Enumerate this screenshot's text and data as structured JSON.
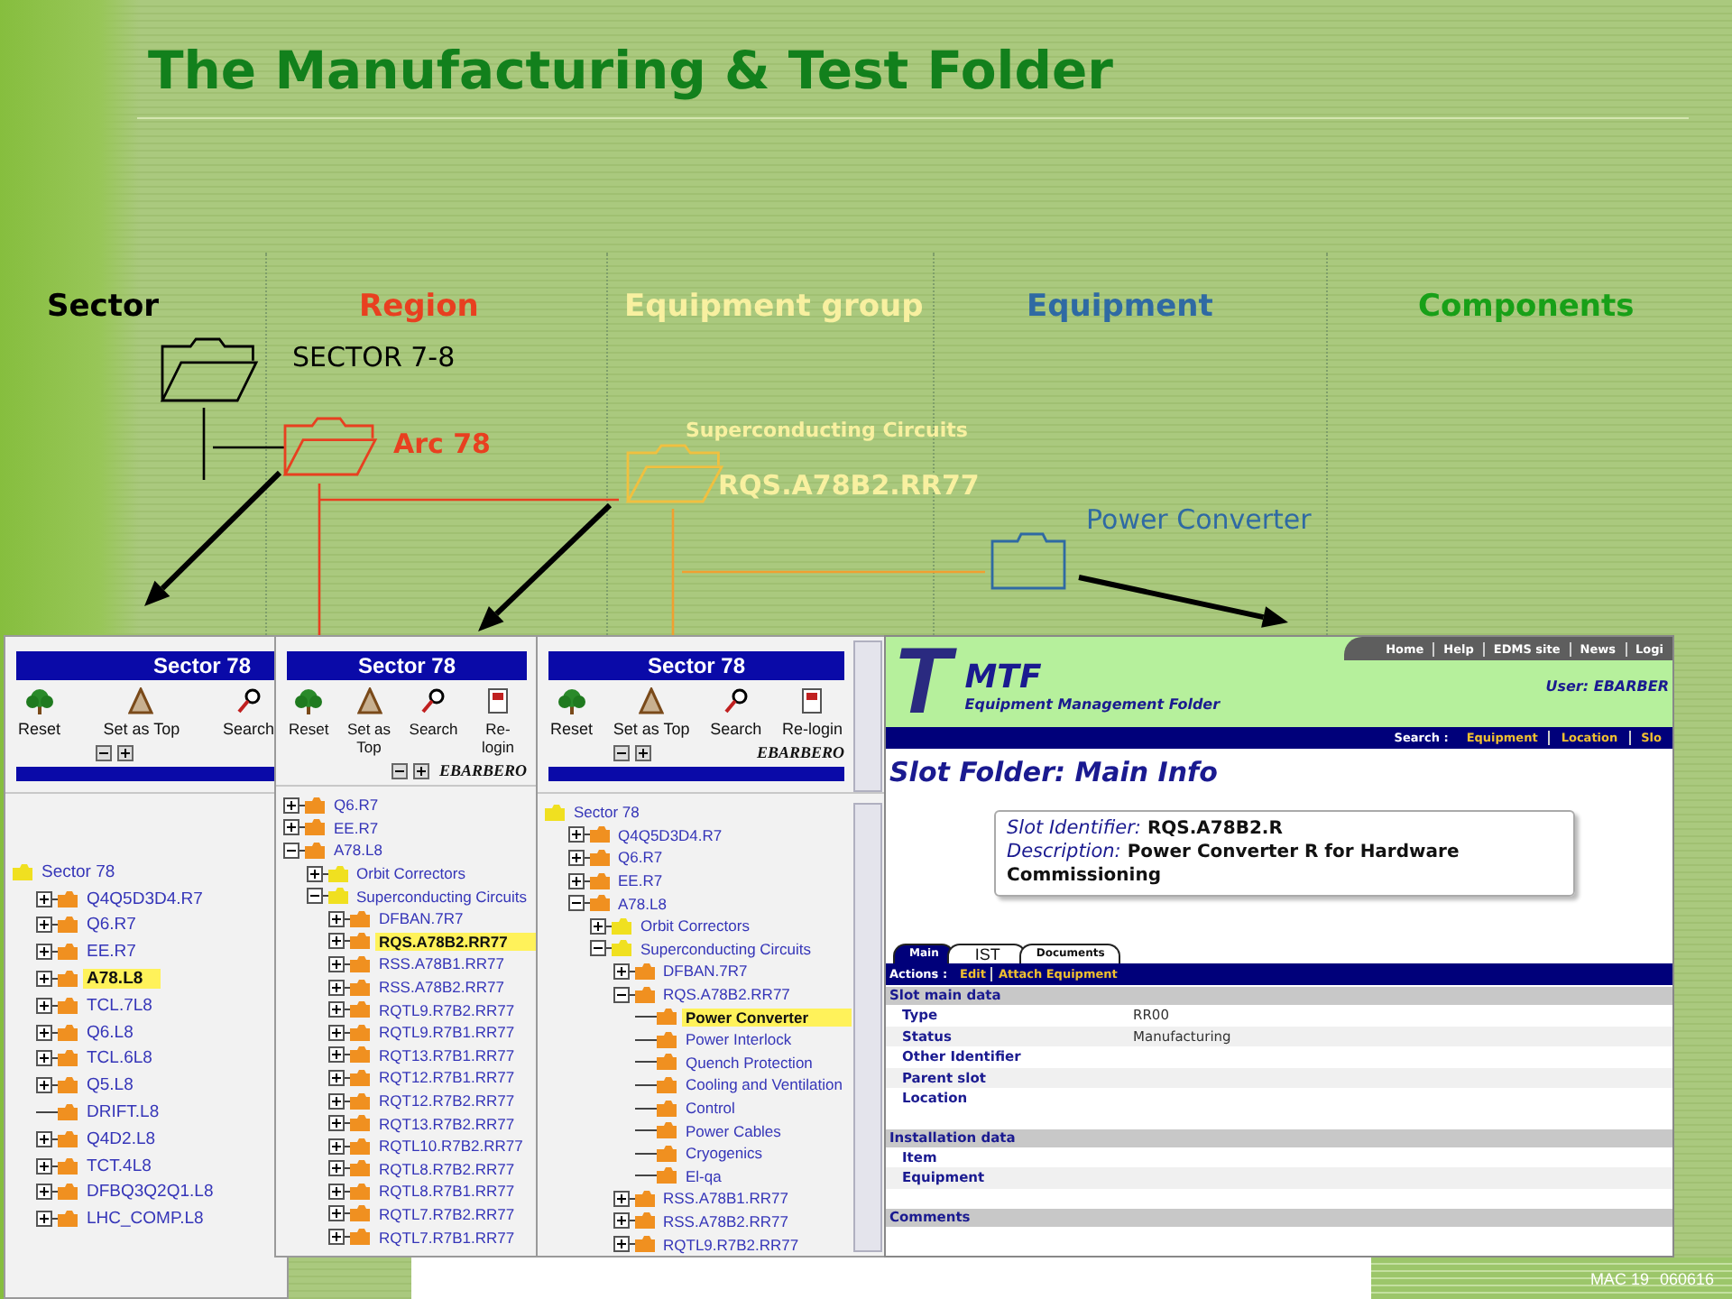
{
  "title": "The Manufacturing & Test Folder",
  "columns": [
    {
      "label": "Sector",
      "color": "#000000"
    },
    {
      "label": "Region",
      "color": "#e84020"
    },
    {
      "label": "Equipment group",
      "color": "#f8f0a0"
    },
    {
      "label": "Equipment",
      "color": "#2f6aa3"
    },
    {
      "label": "Components",
      "color": "#18a018"
    }
  ],
  "diagram": [
    {
      "label": "SECTOR 7-8",
      "color": "#000000"
    },
    {
      "label": "Arc 78",
      "color": "#e84020"
    },
    {
      "label": "RQS.A78B2.RR77",
      "caption": "Superconducting Circuits",
      "color": "#f0c040"
    },
    {
      "label": "Power Converter",
      "color": "#2f6aa3"
    }
  ],
  "panels": [
    {
      "header": "Sector 78",
      "toolbar": [
        {
          "kind": "reset",
          "label": "Reset"
        },
        {
          "kind": "top",
          "label": "Set as Top"
        },
        {
          "kind": "search",
          "label": "Search"
        }
      ],
      "tree": [
        {
          "label": "Sector 78",
          "color": "#f0e020",
          "selected": false,
          "children": [
            {
              "label": "Q4Q5D3D4.R7",
              "color": "#f09020",
              "expanded": false,
              "selected": false
            },
            {
              "label": "Q6.R7",
              "color": "#f09020",
              "expanded": false,
              "selected": false
            },
            {
              "label": "EE.R7",
              "color": "#f09020",
              "expanded": false,
              "selected": false
            },
            {
              "label": "A78.L8",
              "color": "#f09020",
              "expanded": false,
              "selected": true
            },
            {
              "label": "TCL.7L8",
              "color": "#f09020",
              "expanded": false,
              "selected": false
            },
            {
              "label": "Q6.L8",
              "color": "#f09020",
              "expanded": false,
              "selected": false
            },
            {
              "label": "TCL.6L8",
              "color": "#f09020",
              "expanded": false,
              "selected": false
            },
            {
              "label": "Q5.L8",
              "color": "#f09020",
              "expanded": false,
              "selected": false
            },
            {
              "label": "DRIFT.L8",
              "color": "#f09020",
              "selected": false
            },
            {
              "label": "Q4D2.L8",
              "color": "#f09020",
              "expanded": false,
              "selected": false
            },
            {
              "label": "TCT.4L8",
              "color": "#f09020",
              "expanded": false,
              "selected": false
            },
            {
              "label": "DFBQ3Q2Q1.L8",
              "color": "#f09020",
              "expanded": false,
              "selected": false
            },
            {
              "label": "LHC_COMP.L8",
              "color": "#f09020",
              "expanded": false,
              "selected": false
            }
          ]
        }
      ]
    },
    {
      "header": "Sector 78",
      "toolbar": [
        {
          "kind": "reset",
          "label": "Reset"
        },
        {
          "kind": "top",
          "label": "Set as Top"
        },
        {
          "kind": "search",
          "label": "Search"
        },
        {
          "kind": "relogin",
          "label": "Re-login"
        }
      ],
      "user": "EBARBERO",
      "tree": [
        {
          "label": "Q6.R7",
          "color": "#f09020",
          "expanded": false,
          "selected": false
        },
        {
          "label": "EE.R7",
          "color": "#f09020",
          "expanded": false,
          "selected": false
        },
        {
          "label": "A78.L8",
          "color": "#f09020",
          "expanded": true,
          "selected": false,
          "children": [
            {
              "label": "Orbit Correctors",
              "color": "#f0e020",
              "expanded": false,
              "selected": false
            },
            {
              "label": "Superconducting Circuits",
              "color": "#f0e020",
              "expanded": true,
              "selected": false,
              "children": [
                {
                  "label": "DFBAN.7R7",
                  "color": "#f09020",
                  "expanded": false,
                  "selected": false
                },
                {
                  "label": "RQS.A78B2.RR77",
                  "color": "#f09020",
                  "expanded": false,
                  "selected": true
                },
                {
                  "label": "RSS.A78B1.RR77",
                  "color": "#f09020",
                  "expanded": false,
                  "selected": false
                },
                {
                  "label": "RSS.A78B2.RR77",
                  "color": "#f09020",
                  "expanded": false,
                  "selected": false
                },
                {
                  "label": "RQTL9.R7B2.RR77",
                  "color": "#f09020",
                  "expanded": false,
                  "selected": false
                },
                {
                  "label": "RQTL9.R7B1.RR77",
                  "color": "#f09020",
                  "expanded": false,
                  "selected": false
                },
                {
                  "label": "RQT13.R7B1.RR77",
                  "color": "#f09020",
                  "expanded": false,
                  "selected": false
                },
                {
                  "label": "RQT12.R7B1.RR77",
                  "color": "#f09020",
                  "expanded": false,
                  "selected": false
                },
                {
                  "label": "RQT12.R7B2.RR77",
                  "color": "#f09020",
                  "expanded": false,
                  "selected": false
                },
                {
                  "label": "RQT13.R7B2.RR77",
                  "color": "#f09020",
                  "expanded": false,
                  "selected": false
                },
                {
                  "label": "RQTL10.R7B2.RR77",
                  "color": "#f09020",
                  "expanded": false,
                  "selected": false
                },
                {
                  "label": "RQTL8.R7B2.RR77",
                  "color": "#f09020",
                  "expanded": false,
                  "selected": false
                },
                {
                  "label": "RQTL8.R7B1.RR77",
                  "color": "#f09020",
                  "expanded": false,
                  "selected": false
                },
                {
                  "label": "RQTL7.R7B2.RR77",
                  "color": "#f09020",
                  "expanded": false,
                  "selected": false
                },
                {
                  "label": "RQTL7.R7B1.RR77",
                  "color": "#f09020",
                  "expanded": false,
                  "selected": false
                }
              ]
            }
          ]
        }
      ]
    },
    {
      "header": "Sector 78",
      "toolbar": [
        {
          "kind": "reset",
          "label": "Reset"
        },
        {
          "kind": "top",
          "label": "Set as Top"
        },
        {
          "kind": "search",
          "label": "Search"
        },
        {
          "kind": "relogin",
          "label": "Re-login"
        }
      ],
      "user": "EBARBERO",
      "tree": [
        {
          "label": "Sector 78",
          "color": "#f0e020",
          "selected": false,
          "children": [
            {
              "label": "Q4Q5D3D4.R7",
              "color": "#f09020",
              "expanded": false,
              "selected": false
            },
            {
              "label": "Q6.R7",
              "color": "#f09020",
              "expanded": false,
              "selected": false
            },
            {
              "label": "EE.R7",
              "color": "#f09020",
              "expanded": false,
              "selected": false
            },
            {
              "label": "A78.L8",
              "color": "#f09020",
              "expanded": true,
              "selected": false,
              "children": [
                {
                  "label": "Orbit Correctors",
                  "color": "#f0e020",
                  "expanded": false,
                  "selected": false
                },
                {
                  "label": "Superconducting Circuits",
                  "color": "#f0e020",
                  "expanded": true,
                  "selected": false,
                  "children": [
                    {
                      "label": "DFBAN.7R7",
                      "color": "#f09020",
                      "expanded": false,
                      "selected": false
                    },
                    {
                      "label": "RQS.A78B2.RR77",
                      "color": "#f09020",
                      "expanded": true,
                      "selected": false,
                      "children": [
                        {
                          "label": "Power Converter",
                          "color": "#f09020",
                          "selected": true
                        },
                        {
                          "label": "Power Interlock",
                          "color": "#f09020",
                          "selected": false
                        },
                        {
                          "label": "Quench Protection",
                          "color": "#f09020",
                          "selected": false
                        },
                        {
                          "label": "Cooling and Ventilation",
                          "color": "#f09020",
                          "selected": false
                        },
                        {
                          "label": "Control",
                          "color": "#f09020",
                          "selected": false
                        },
                        {
                          "label": "Power Cables",
                          "color": "#f09020",
                          "selected": false
                        },
                        {
                          "label": "Cryogenics",
                          "color": "#f09020",
                          "selected": false
                        },
                        {
                          "label": "El-qa",
                          "color": "#f09020",
                          "selected": false
                        }
                      ]
                    },
                    {
                      "label": "RSS.A78B1.RR77",
                      "color": "#f09020",
                      "expanded": false,
                      "selected": false
                    },
                    {
                      "label": "RSS.A78B2.RR77",
                      "color": "#f09020",
                      "expanded": false,
                      "selected": false
                    },
                    {
                      "label": "RQTL9.R7B2.RR77",
                      "color": "#f09020",
                      "expanded": false,
                      "selected": false
                    }
                  ]
                }
              ]
            }
          ]
        }
      ]
    }
  ],
  "mtf": {
    "logo_letter": "T",
    "app_name": "MTF",
    "subtitle": "Equipment Management Folder",
    "nav_links": [
      "Home",
      "Help",
      "EDMS site",
      "News",
      "Logi"
    ],
    "user": "User: EBARBER",
    "search_label": "Search :",
    "search_links": [
      "Equipment",
      "Location",
      "Slo"
    ],
    "page_title": "Slot Folder: Main Info",
    "identifier_label": "Slot Identifier:",
    "identifier": "RQS.A78B2.R",
    "description_label": "Description:",
    "description": "Power Converter R for Hardware Commissioning",
    "tabs": [
      {
        "label": "Main",
        "selected": true
      },
      {
        "label": "IST",
        "selected": false
      },
      {
        "label": "Documents",
        "selected": false
      }
    ],
    "actions_label": "Actions :",
    "actions": [
      "Edit",
      "Attach Equipment"
    ],
    "sections": [
      {
        "title": "Slot main data",
        "rows": [
          {
            "label": "Type",
            "value": "RR00"
          },
          {
            "label": "Status",
            "value": "Manufacturing"
          },
          {
            "label": "Other Identifier"
          },
          {
            "label": "Parent slot"
          },
          {
            "label": "Location"
          }
        ]
      },
      {
        "title": "Installation data",
        "rows": [
          {
            "label": "Item"
          },
          {
            "label": "Equipment"
          }
        ]
      },
      {
        "title": "Comments"
      }
    ]
  },
  "footer": {
    "code": "MAC 19",
    "date": "060616"
  }
}
